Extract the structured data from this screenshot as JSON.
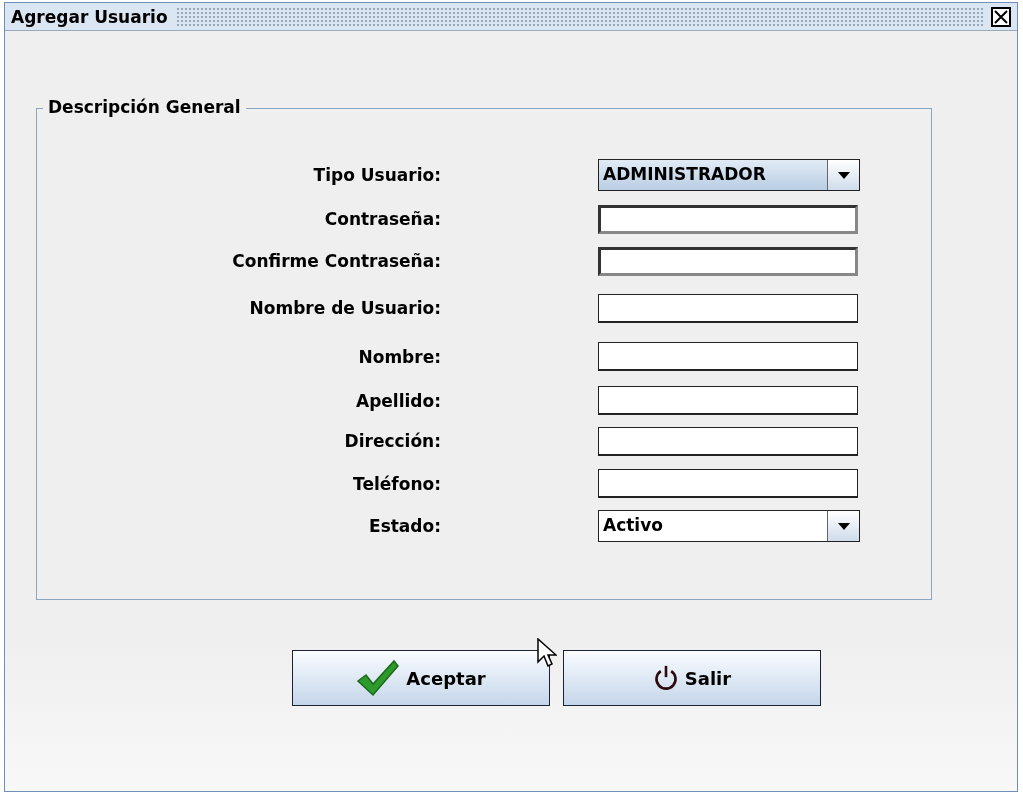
{
  "window": {
    "title": "Agregar Usuario"
  },
  "group": {
    "title": "Descripción General"
  },
  "fields": [
    {
      "label": "Tipo Usuario:",
      "kind": "select",
      "value": "ADMINISTRADOR",
      "highlighted": true
    },
    {
      "label": "Contraseña:",
      "kind": "password"
    },
    {
      "label": "Confirme Contraseña:",
      "kind": "password"
    },
    {
      "label": "Nombre de Usuario:",
      "kind": "text"
    },
    {
      "label": "Nombre:",
      "kind": "text"
    },
    {
      "label": "Apellido:",
      "kind": "text"
    },
    {
      "label": "Dirección:",
      "kind": "text"
    },
    {
      "label": "Teléfono:",
      "kind": "text"
    },
    {
      "label": "Estado:",
      "kind": "select",
      "value": "Activo",
      "highlighted": false
    }
  ],
  "buttons": [
    {
      "label": "Aceptar",
      "kind": "ok"
    },
    {
      "label": "Salir",
      "kind": "exit"
    }
  ]
}
